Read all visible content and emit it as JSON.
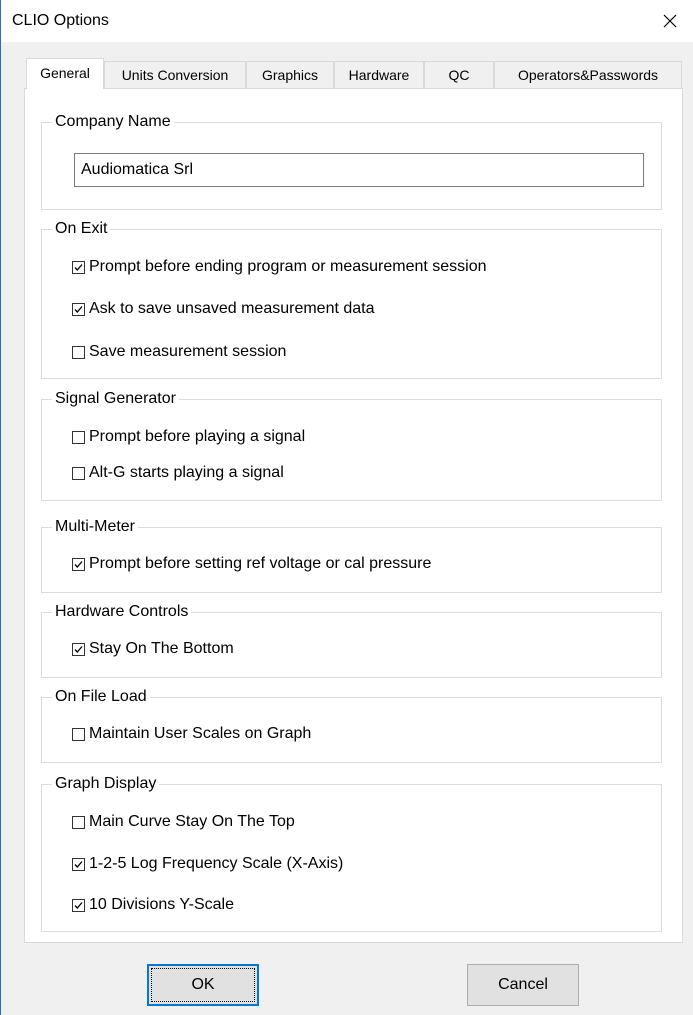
{
  "window": {
    "title": "CLIO Options",
    "close_icon": "close-icon"
  },
  "tabs": [
    {
      "label": "General",
      "active": true
    },
    {
      "label": "Units Conversion",
      "active": false
    },
    {
      "label": "Graphics",
      "active": false
    },
    {
      "label": "Hardware",
      "active": false
    },
    {
      "label": "QC",
      "active": false
    },
    {
      "label": "Operators&Passwords",
      "active": false
    }
  ],
  "general": {
    "company": {
      "group_label": "Company Name",
      "value": "Audiomatica Srl"
    },
    "on_exit": {
      "group_label": "On Exit",
      "options": [
        {
          "label": "Prompt before ending program or measurement session",
          "checked": true
        },
        {
          "label": "Ask to save unsaved measurement data",
          "checked": true
        },
        {
          "label": "Save measurement session",
          "checked": false
        }
      ]
    },
    "signal_generator": {
      "group_label": "Signal Generator",
      "options": [
        {
          "label": "Prompt before playing a signal",
          "checked": false
        },
        {
          "label": "Alt-G starts playing a signal",
          "checked": false
        }
      ]
    },
    "multi_meter": {
      "group_label": "Multi-Meter",
      "options": [
        {
          "label": "Prompt before setting ref voltage or cal pressure",
          "checked": true
        }
      ]
    },
    "hardware_controls": {
      "group_label": "Hardware Controls",
      "options": [
        {
          "label": "Stay On The Bottom",
          "checked": true
        }
      ]
    },
    "on_file_load": {
      "group_label": "On File Load",
      "options": [
        {
          "label": "Maintain User Scales on Graph",
          "checked": false
        }
      ]
    },
    "graph_display": {
      "group_label": "Graph Display",
      "options": [
        {
          "label": "Main Curve Stay On The Top",
          "checked": false
        },
        {
          "label": "1-2-5 Log Frequency Scale (X-Axis)",
          "checked": true
        },
        {
          "label": "10 Divisions Y-Scale",
          "checked": true
        }
      ]
    }
  },
  "buttons": {
    "ok": "OK",
    "cancel": "Cancel"
  }
}
